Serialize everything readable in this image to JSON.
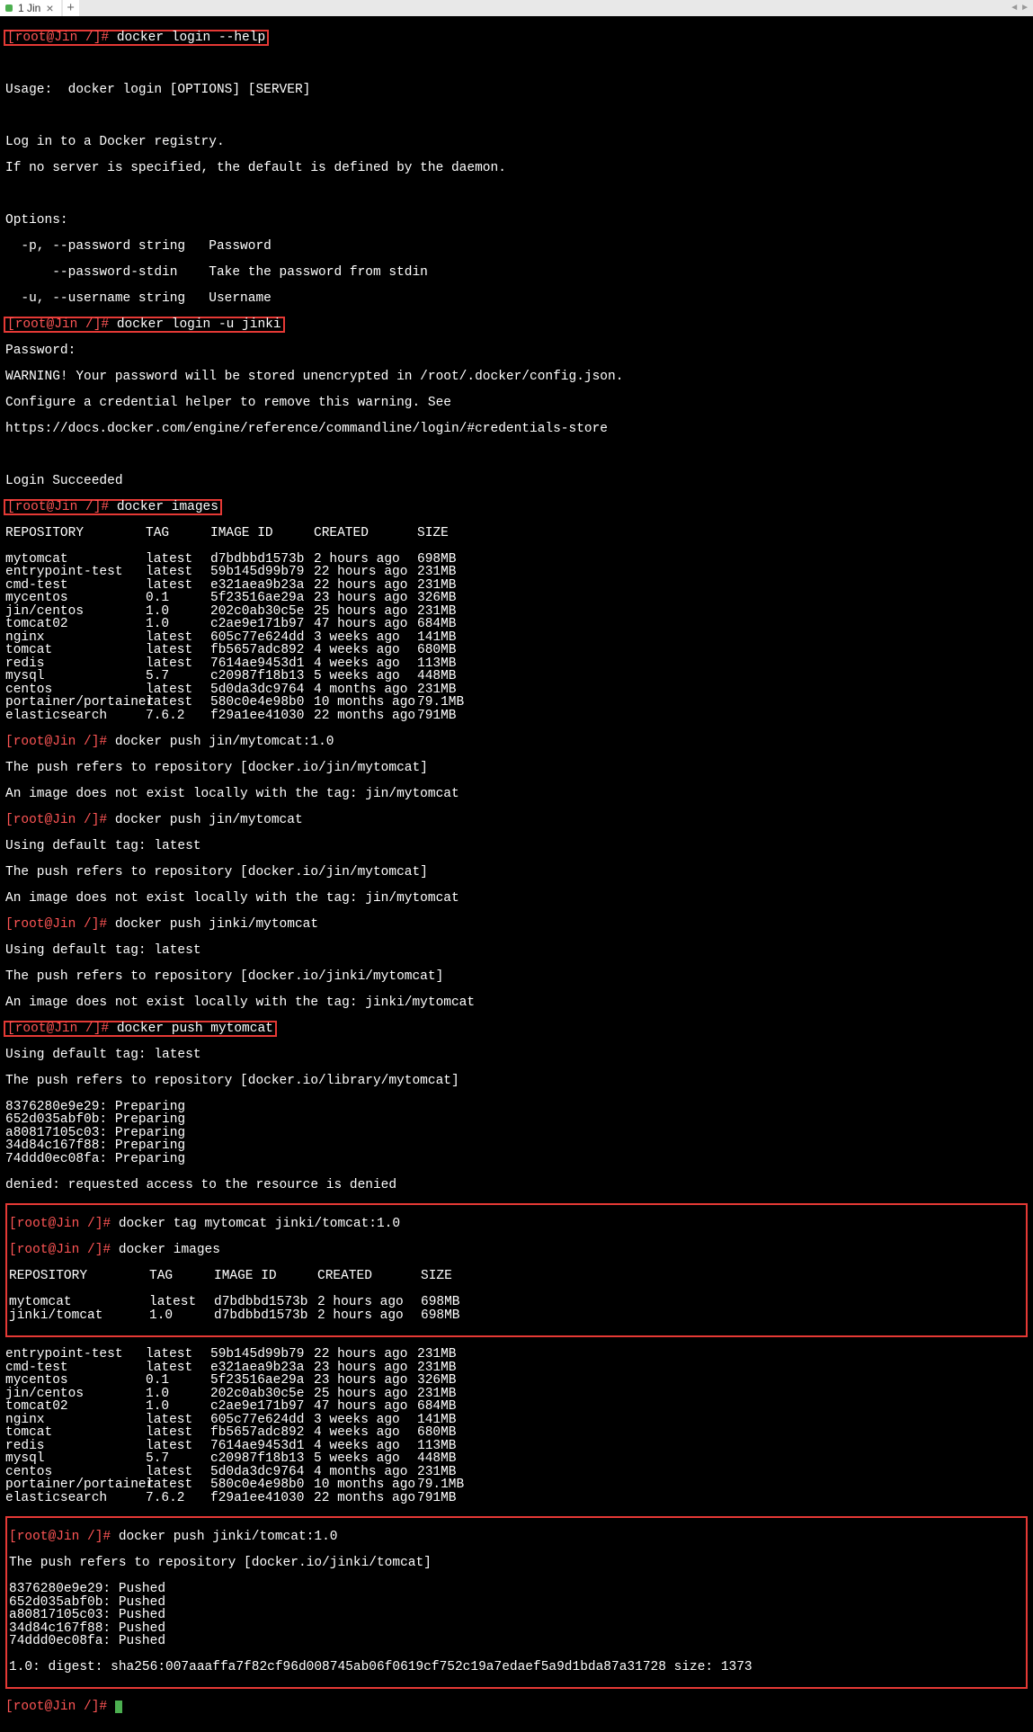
{
  "tab": {
    "label": "1 Jin",
    "close": "×",
    "new": "+"
  },
  "prompt": "[root@Jin /]# ",
  "cmd1": "docker login --help",
  "usage": "Usage:  docker login [OPTIONS] [SERVER]",
  "desc1": "Log in to a Docker registry.",
  "desc2": "If no server is specified, the default is defined by the daemon.",
  "opt_hdr": "Options:",
  "opt_p": "  -p, --password string   Password",
  "opt_ps": "      --password-stdin    Take the password from stdin",
  "opt_u": "  -u, --username string   Username",
  "cmd2": "docker login -u jinki",
  "pw_label": "Password:",
  "warn1": "WARNING! Your password will be stored unencrypted in /root/.docker/config.json.",
  "warn2": "Configure a credential helper to remove this warning. See",
  "warn3": "https://docs.docker.com/engine/reference/commandline/login/#credentials-store",
  "login_ok": "Login Succeeded",
  "cmd3": "docker images",
  "hdr": {
    "repo": "REPOSITORY",
    "tag": "TAG",
    "id": "IMAGE ID",
    "created": "CREATED",
    "size": "SIZE"
  },
  "images1": [
    {
      "repo": "mytomcat",
      "tag": "latest",
      "id": "d7bdbbd1573b",
      "created": "2 hours ago",
      "size": "698MB"
    },
    {
      "repo": "entrypoint-test",
      "tag": "latest",
      "id": "59b145d99b79",
      "created": "22 hours ago",
      "size": "231MB"
    },
    {
      "repo": "cmd-test",
      "tag": "latest",
      "id": "e321aea9b23a",
      "created": "22 hours ago",
      "size": "231MB"
    },
    {
      "repo": "mycentos",
      "tag": "0.1",
      "id": "5f23516ae29a",
      "created": "23 hours ago",
      "size": "326MB"
    },
    {
      "repo": "jin/centos",
      "tag": "1.0",
      "id": "202c0ab30c5e",
      "created": "25 hours ago",
      "size": "231MB"
    },
    {
      "repo": "tomcat02",
      "tag": "1.0",
      "id": "c2ae9e171b97",
      "created": "47 hours ago",
      "size": "684MB"
    },
    {
      "repo": "nginx",
      "tag": "latest",
      "id": "605c77e624dd",
      "created": "3 weeks ago",
      "size": "141MB"
    },
    {
      "repo": "tomcat",
      "tag": "latest",
      "id": "fb5657adc892",
      "created": "4 weeks ago",
      "size": "680MB"
    },
    {
      "repo": "redis",
      "tag": "latest",
      "id": "7614ae9453d1",
      "created": "4 weeks ago",
      "size": "113MB"
    },
    {
      "repo": "mysql",
      "tag": "5.7",
      "id": "c20987f18b13",
      "created": "5 weeks ago",
      "size": "448MB"
    },
    {
      "repo": "centos",
      "tag": "latest",
      "id": "5d0da3dc9764",
      "created": "4 months ago",
      "size": "231MB"
    },
    {
      "repo": "portainer/portainer",
      "tag": "latest",
      "id": "580c0e4e98b0",
      "created": "10 months ago",
      "size": "79.1MB"
    },
    {
      "repo": "elasticsearch",
      "tag": "7.6.2",
      "id": "f29a1ee41030",
      "created": "22 months ago",
      "size": "791MB"
    }
  ],
  "push_cmd1": "docker push jin/mytomcat:1.0",
  "push_ref1": "The push refers to repository [docker.io/jin/mytomcat]",
  "push_err1": "An image does not exist locally with the tag: jin/mytomcat",
  "push_cmd2": "docker push jin/mytomcat",
  "push_deftag": "Using default tag: latest",
  "push_cmd3": "docker push jinki/mytomcat",
  "push_ref3": "The push refers to repository [docker.io/jinki/mytomcat]",
  "push_err3": "An image does not exist locally with the tag: jinki/mytomcat",
  "push_cmd4": "docker push mytomcat",
  "push_ref4": "The push refers to repository [docker.io/library/mytomcat]",
  "layers_prep": [
    "8376280e9e29: Preparing",
    "652d035abf0b: Preparing",
    "a80817105c03: Preparing",
    "34d84c167f88: Preparing",
    "74ddd0ec08fa: Preparing"
  ],
  "denied": "denied: requested access to the resource is denied",
  "tag_cmd": "docker tag mytomcat jinki/tomcat:1.0",
  "images2_boxed": [
    {
      "repo": "mytomcat",
      "tag": "latest",
      "id": "d7bdbbd1573b",
      "created": "2 hours ago",
      "size": "698MB"
    },
    {
      "repo": "jinki/tomcat",
      "tag": "1.0",
      "id": "d7bdbbd1573b",
      "created": "2 hours ago",
      "size": "698MB"
    }
  ],
  "images2_rest": [
    {
      "repo": "entrypoint-test",
      "tag": "latest",
      "id": "59b145d99b79",
      "created": "22 hours ago",
      "size": "231MB"
    },
    {
      "repo": "cmd-test",
      "tag": "latest",
      "id": "e321aea9b23a",
      "created": "23 hours ago",
      "size": "231MB"
    },
    {
      "repo": "mycentos",
      "tag": "0.1",
      "id": "5f23516ae29a",
      "created": "23 hours ago",
      "size": "326MB"
    },
    {
      "repo": "jin/centos",
      "tag": "1.0",
      "id": "202c0ab30c5e",
      "created": "25 hours ago",
      "size": "231MB"
    },
    {
      "repo": "tomcat02",
      "tag": "1.0",
      "id": "c2ae9e171b97",
      "created": "47 hours ago",
      "size": "684MB"
    },
    {
      "repo": "nginx",
      "tag": "latest",
      "id": "605c77e624dd",
      "created": "3 weeks ago",
      "size": "141MB"
    },
    {
      "repo": "tomcat",
      "tag": "latest",
      "id": "fb5657adc892",
      "created": "4 weeks ago",
      "size": "680MB"
    },
    {
      "repo": "redis",
      "tag": "latest",
      "id": "7614ae9453d1",
      "created": "4 weeks ago",
      "size": "113MB"
    },
    {
      "repo": "mysql",
      "tag": "5.7",
      "id": "c20987f18b13",
      "created": "5 weeks ago",
      "size": "448MB"
    },
    {
      "repo": "centos",
      "tag": "latest",
      "id": "5d0da3dc9764",
      "created": "4 months ago",
      "size": "231MB"
    },
    {
      "repo": "portainer/portainer",
      "tag": "latest",
      "id": "580c0e4e98b0",
      "created": "10 months ago",
      "size": "79.1MB"
    },
    {
      "repo": "elasticsearch",
      "tag": "7.6.2",
      "id": "f29a1ee41030",
      "created": "22 months ago",
      "size": "791MB"
    }
  ],
  "push_cmd5": "docker push jinki/tomcat:1.0",
  "push_ref5": "The push refers to repository [docker.io/jinki/tomcat]",
  "layers_pushed": [
    "8376280e9e29: Pushed",
    "652d035abf0b: Pushed",
    "a80817105c03: Pushed",
    "34d84c167f88: Pushed",
    "74ddd0ec08fa: Pushed"
  ],
  "digest": "1.0: digest: sha256:007aaaffa7f82cf96d008745ab06f0619cf752c19a7edaef5a9d1bda87a31728 size: 1373"
}
